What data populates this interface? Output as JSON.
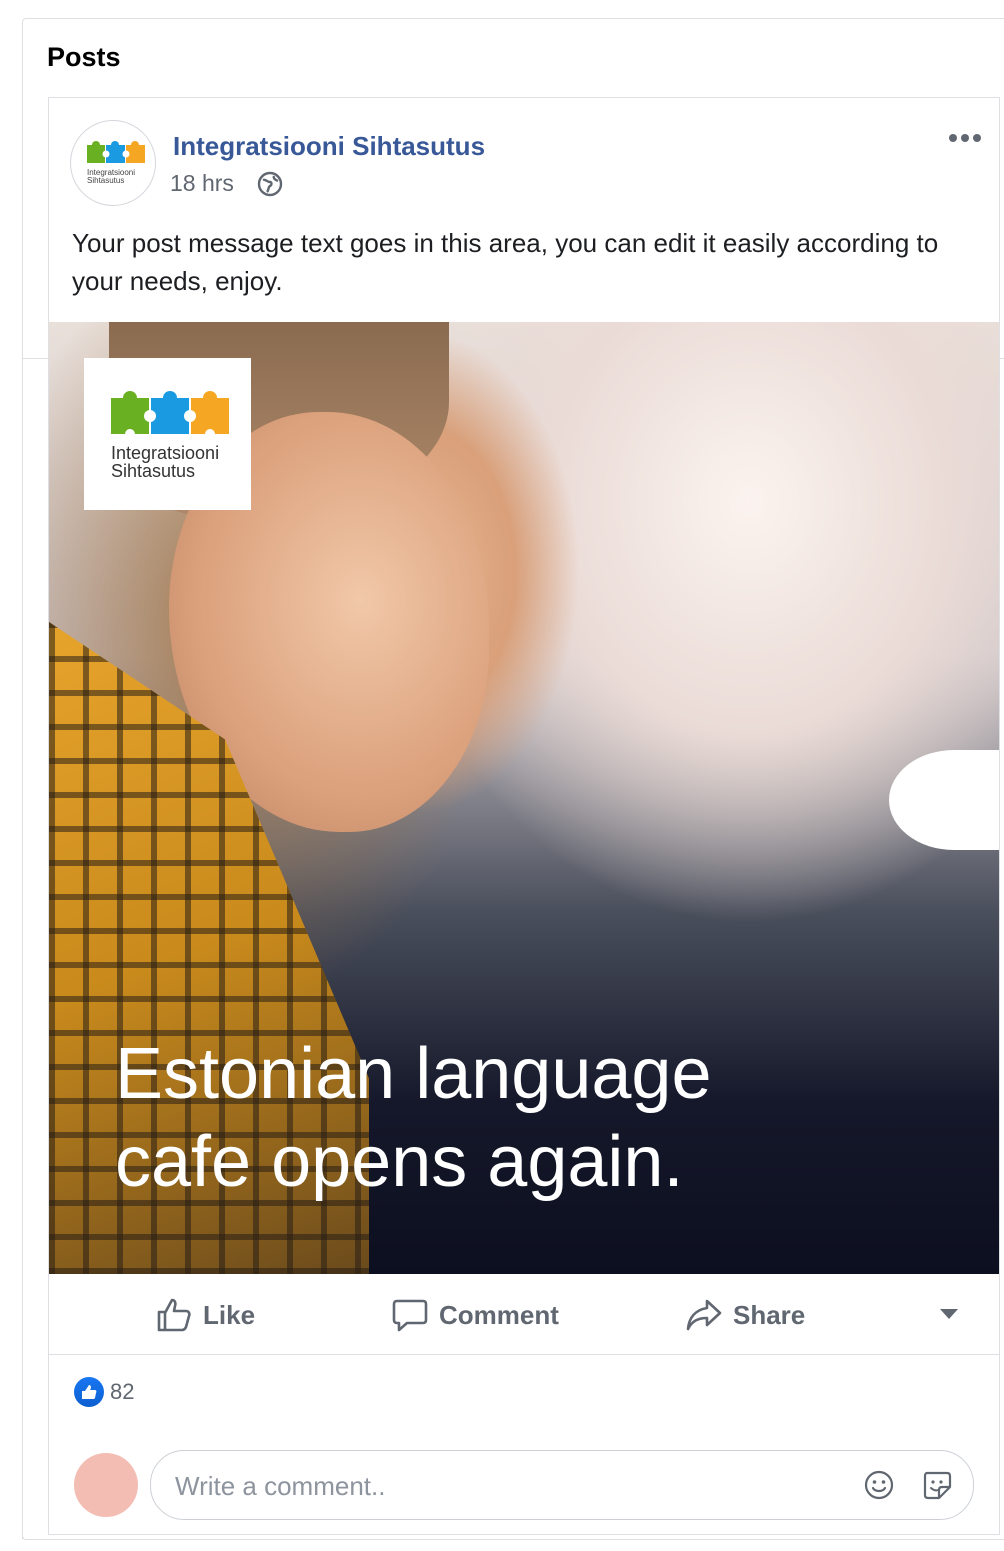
{
  "section": {
    "title": "Posts"
  },
  "post": {
    "page_name": "Integratsiooni Sihtasutus",
    "timestamp": "18 hrs",
    "privacy_icon": "globe-icon",
    "more_icon": "more-dots-icon",
    "message": "Your post message text goes in this area, you can edit it easily according to your needs, enjoy.",
    "avatar_logo_text": "Integratsiooni Sihtasutus",
    "image": {
      "logo_line1": "Integratsiooni",
      "logo_line2": "Sihtasutus",
      "headline_line1": "Estonian language",
      "headline_line2": "cafe opens again."
    },
    "actions": {
      "like": "Like",
      "comment": "Comment",
      "share": "Share"
    },
    "reactions": {
      "count": "82"
    },
    "comment_input": {
      "placeholder": "Write a comment.."
    }
  },
  "colors": {
    "page_name": "#385898",
    "like_blue": "#1877f2",
    "puzzle_green": "#6ab023",
    "puzzle_blue": "#1a9ae0",
    "puzzle_orange": "#f5a623"
  }
}
